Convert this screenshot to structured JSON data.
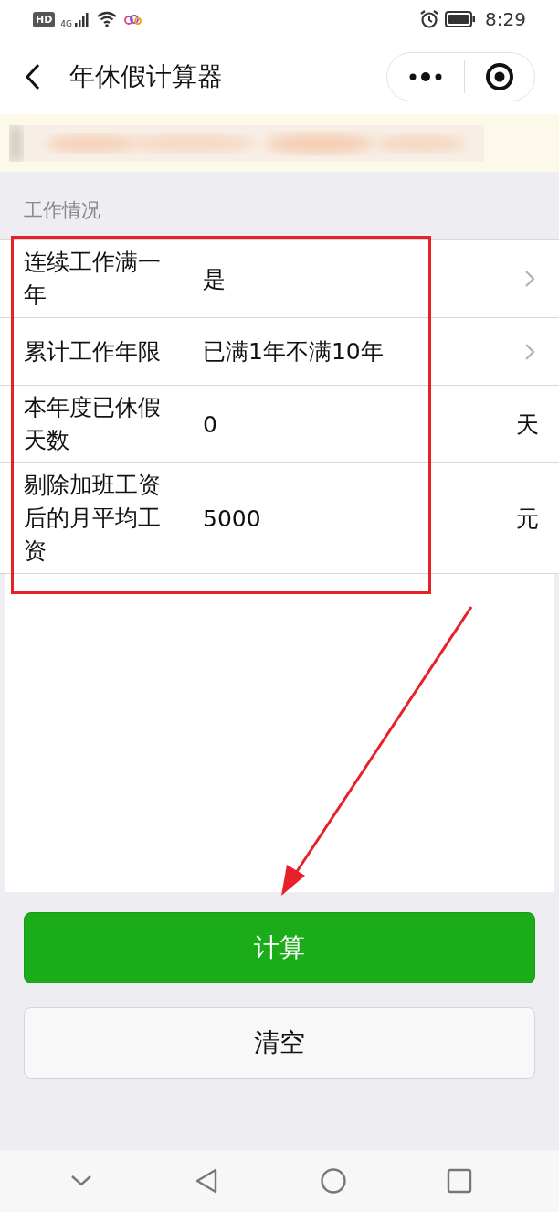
{
  "status_bar": {
    "hd_badge": "HD",
    "network": "4G",
    "time": "8:29"
  },
  "nav": {
    "title": "年休假计算器"
  },
  "section": {
    "title": "工作情况"
  },
  "rows": [
    {
      "kind": "select",
      "label": "连续工作满一年",
      "value": "是"
    },
    {
      "kind": "select",
      "label": "累计工作年限",
      "value": "已满1年不满10年"
    },
    {
      "kind": "input",
      "label": "本年度已休假天数",
      "value": "0",
      "unit": "天"
    },
    {
      "kind": "input",
      "label": "剔除加班工资后的月平均工资",
      "value": "5000",
      "unit": "元"
    }
  ],
  "buttons": [
    {
      "kind": "primary",
      "label": "计算"
    },
    {
      "kind": "default",
      "label": "清空"
    }
  ]
}
